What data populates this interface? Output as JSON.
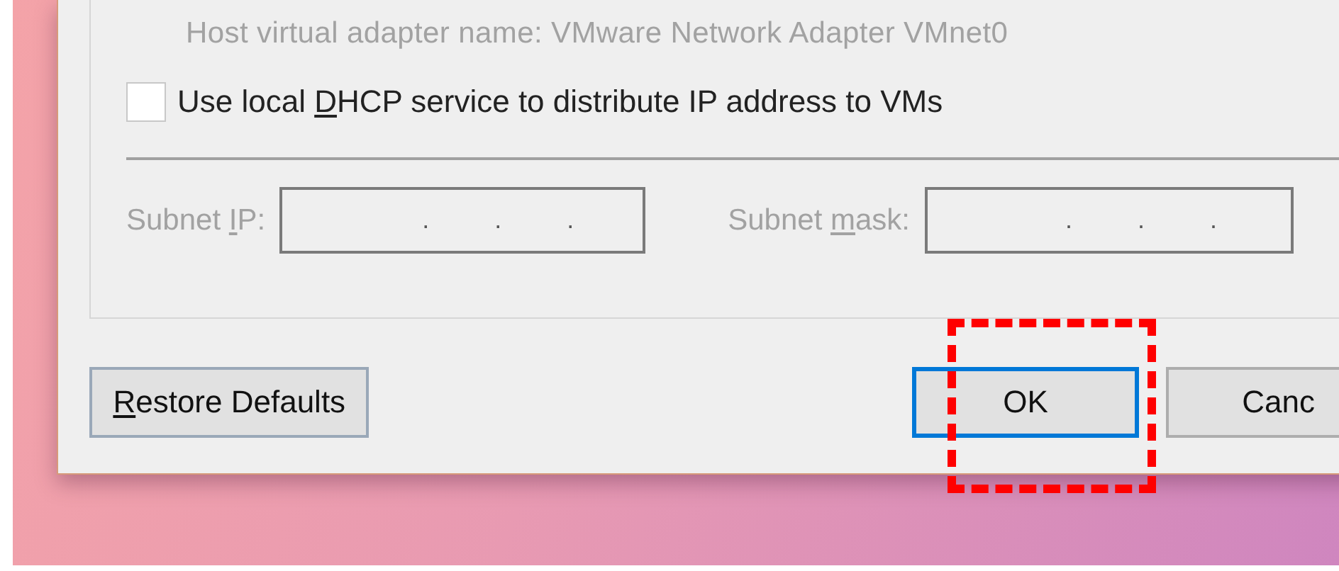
{
  "adapter_name": {
    "text": "Host virtual adapter name: VMware Network Adapter VMnet0",
    "disabled": true
  },
  "dhcp": {
    "label": [
      {
        "text": "Use local ",
        "underline": false
      },
      {
        "text": "D",
        "underline": true
      },
      {
        "text": "HCP service to distribute IP address to VMs",
        "underline": false
      }
    ],
    "checked": false
  },
  "subnet_fields": [
    {
      "label": [
        {
          "text": "Subnet ",
          "underline": false
        },
        {
          "text": "I",
          "underline": true
        },
        {
          "text": "P:",
          "underline": false
        }
      ],
      "separators": [
        ".",
        ".",
        "."
      ],
      "disabled": true
    },
    {
      "label": [
        {
          "text": "Subnet ",
          "underline": false
        },
        {
          "text": "m",
          "underline": true
        },
        {
          "text": "ask:",
          "underline": false
        }
      ],
      "separators": [
        ".",
        ".",
        "."
      ],
      "disabled": true
    }
  ],
  "buttons": [
    {
      "kind": "left",
      "label": [
        {
          "text": "R",
          "underline": true
        },
        {
          "text": "estore Defaults",
          "underline": false
        }
      ],
      "focused": false
    },
    {
      "kind": "right",
      "label": [
        {
          "text": "OK",
          "underline": false
        }
      ],
      "focused": true
    },
    {
      "kind": "right",
      "label": [
        {
          "text": "Canc",
          "underline": false
        }
      ],
      "focused": false
    }
  ],
  "annotation": {
    "kind": "dashed-box"
  }
}
